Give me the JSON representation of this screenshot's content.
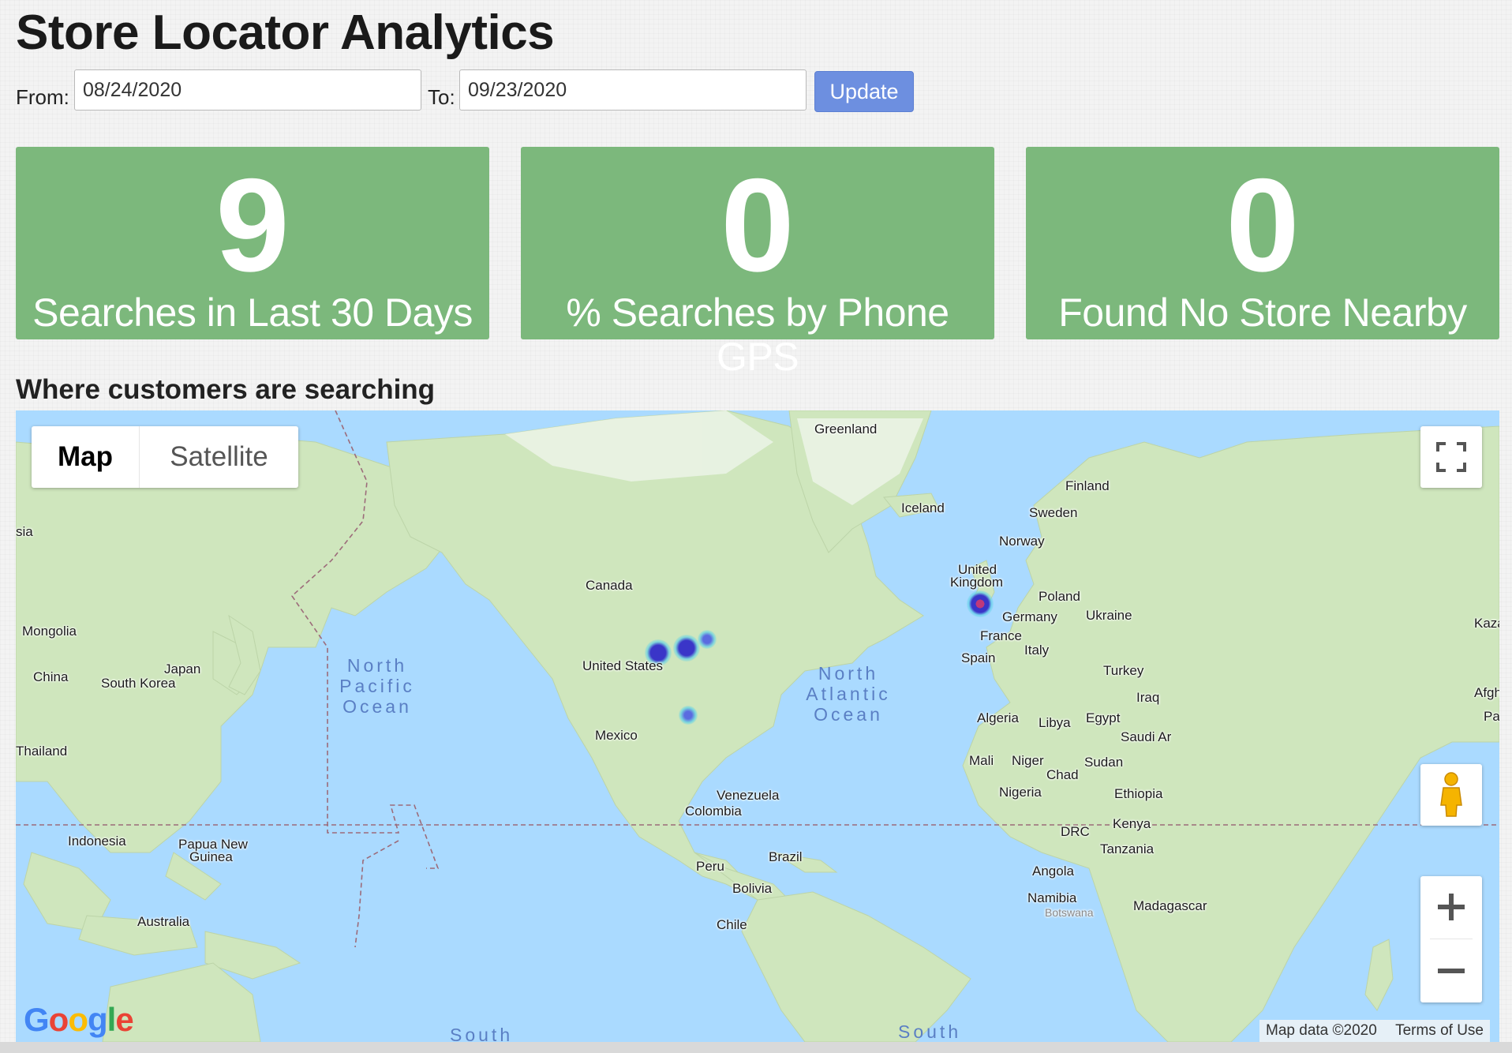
{
  "page": {
    "title": "Store Locator Analytics"
  },
  "date_range": {
    "from_label": "From:",
    "from_value": "08/24/2020",
    "to_label": "To:",
    "to_value": "09/23/2020",
    "update_label": "Update"
  },
  "stats": [
    {
      "value": "9",
      "caption": "Searches in Last 30 Days"
    },
    {
      "value": "0",
      "caption": "% Searches by Phone GPS"
    },
    {
      "value": "0",
      "caption": "Found No Store Nearby"
    }
  ],
  "map_section": {
    "heading": "Where customers are searching",
    "map_type": {
      "map_label": "Map",
      "satellite_label": "Satellite",
      "selected": "Map"
    },
    "labels": {
      "greenland": "Greenland",
      "iceland": "Iceland",
      "finland": "Finland",
      "sweden": "Sweden",
      "norway": "Norway",
      "united_kingdom_1": "United",
      "united_kingdom_2": "Kingdom",
      "poland": "Poland",
      "germany": "Germany",
      "ukraine": "Ukraine",
      "kaza": "Kaza",
      "france": "France",
      "italy": "Italy",
      "spain": "Spain",
      "turkey": "Turkey",
      "iraq": "Iraq",
      "afgh": "Afgh",
      "pa": "Pa",
      "algeria": "Algeria",
      "libya": "Libya",
      "egypt": "Egypt",
      "saudi": "Saudi Ar",
      "mali": "Mali",
      "niger": "Niger",
      "sudan": "Sudan",
      "chad": "Chad",
      "nigeria": "Nigeria",
      "ethiopia": "Ethiopia",
      "kenya": "Kenya",
      "drc": "DRC",
      "tanzania": "Tanzania",
      "angola": "Angola",
      "namibia": "Namibia",
      "madagascar": "Madagascar",
      "canada": "Canada",
      "united_states": "United States",
      "mexico": "Mexico",
      "venezuela": "Venezuela",
      "colombia": "Colombia",
      "brazil": "Brazil",
      "peru": "Peru",
      "bolivia": "Bolivia",
      "chile": "Chile",
      "sia": "sia",
      "mongolia": "Mongolia",
      "china": "China",
      "south_korea": "South Korea",
      "japan": "Japan",
      "thailand": "Thailand",
      "indonesia": "Indonesia",
      "png_1": "Papua New",
      "png_2": "Guinea",
      "australia": "Australia",
      "botswana": "Botswana"
    },
    "oceans": {
      "north_pacific": [
        "North",
        "Pacific",
        "Ocean"
      ],
      "north_atlantic": [
        "North",
        "Atlantic",
        "Ocean"
      ],
      "south_1": "South",
      "south_2": "South"
    },
    "attribution": {
      "map_data": "Map data ©2020",
      "terms": "Terms of Use"
    },
    "google_logo": "Google",
    "zoom_in": "+",
    "zoom_out": "−"
  },
  "colors": {
    "card_bg": "#7cb87c",
    "update_button": "#6d8fe0",
    "water": "#aadaff",
    "land": "#c8e2b4",
    "heat_core": "#3a35c8",
    "heat_glow": "#5fd1e8"
  },
  "icons": [
    "fullscreen-icon",
    "pegman-icon",
    "zoom-in-icon",
    "zoom-out-icon"
  ]
}
